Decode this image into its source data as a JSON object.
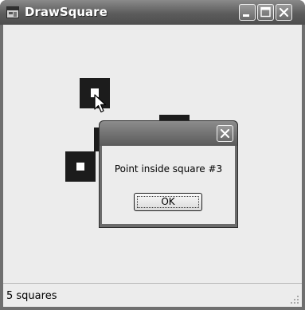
{
  "window": {
    "title": "DrawSquare",
    "app_icon": "form-window-icon",
    "caption_buttons": [
      "minimize-icon",
      "maximize-icon",
      "close-icon"
    ]
  },
  "canvas": {
    "square_color": "#1c1c1c",
    "background": "#ececec"
  },
  "statusbar": {
    "text": "5 squares"
  },
  "dialog": {
    "title": "",
    "close_icon": "close-icon",
    "message": "Point inside square #3",
    "ok_label": "OK"
  },
  "cursor": {
    "icon": "arrow-cursor-icon"
  }
}
